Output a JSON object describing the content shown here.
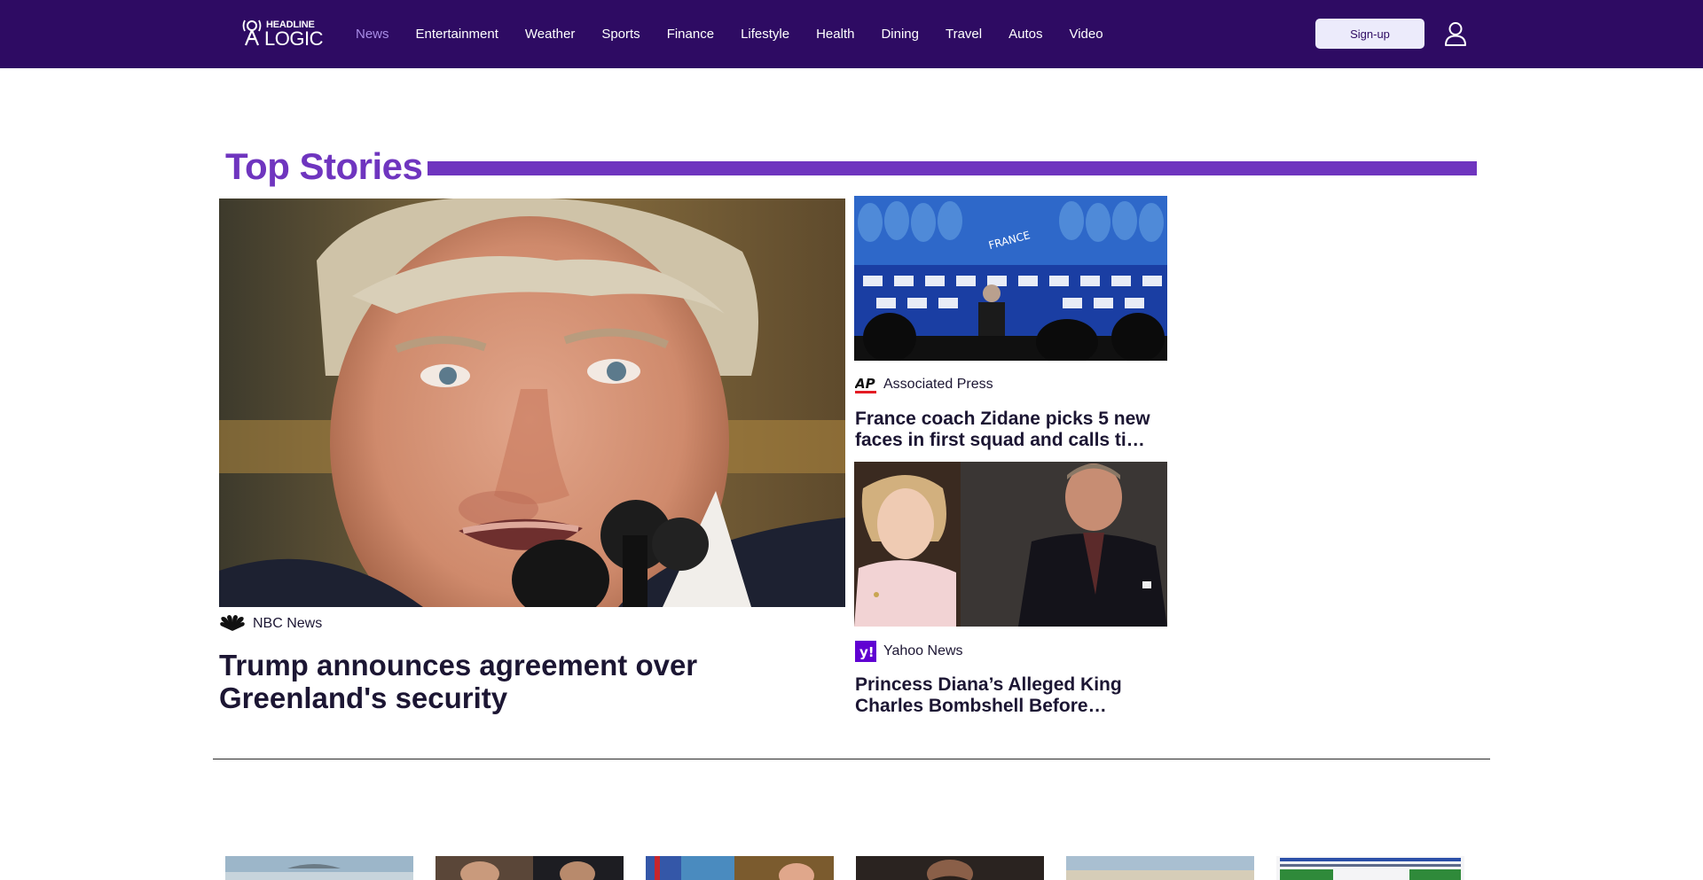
{
  "header": {
    "logo_top": "HEADLINE",
    "logo_bottom": "LOGIC",
    "nav": [
      {
        "label": "News",
        "active": true
      },
      {
        "label": "Entertainment",
        "active": false
      },
      {
        "label": "Weather",
        "active": false
      },
      {
        "label": "Sports",
        "active": false
      },
      {
        "label": "Finance",
        "active": false
      },
      {
        "label": "Lifestyle",
        "active": false
      },
      {
        "label": "Health",
        "active": false
      },
      {
        "label": "Dining",
        "active": false
      },
      {
        "label": "Travel",
        "active": false
      },
      {
        "label": "Autos",
        "active": false
      },
      {
        "label": "Video",
        "active": false
      }
    ],
    "signup_label": "Sign-up",
    "user_icon": "user-icon"
  },
  "top_stories": {
    "title": "Top Stories",
    "lead": {
      "source": "NBC News",
      "source_icon": "nbc-peacock-logo",
      "headline": "Trump announces agreement over Greenland's security"
    },
    "side": [
      {
        "source": "Associated Press",
        "source_icon": "ap-logo",
        "headline": "France coach Zidane picks 5 new faces in first squad and calls ti…"
      },
      {
        "source": "Yahoo News",
        "source_icon": "yahoo-logo",
        "headline": "Princess Diana’s Alleged King Charles Bombshell Before…"
      }
    ]
  },
  "colors": {
    "header_bg": "#2e0b63",
    "accent": "#6f35bf",
    "active_nav": "#a88ce6",
    "signup_bg": "#ecebfb"
  }
}
